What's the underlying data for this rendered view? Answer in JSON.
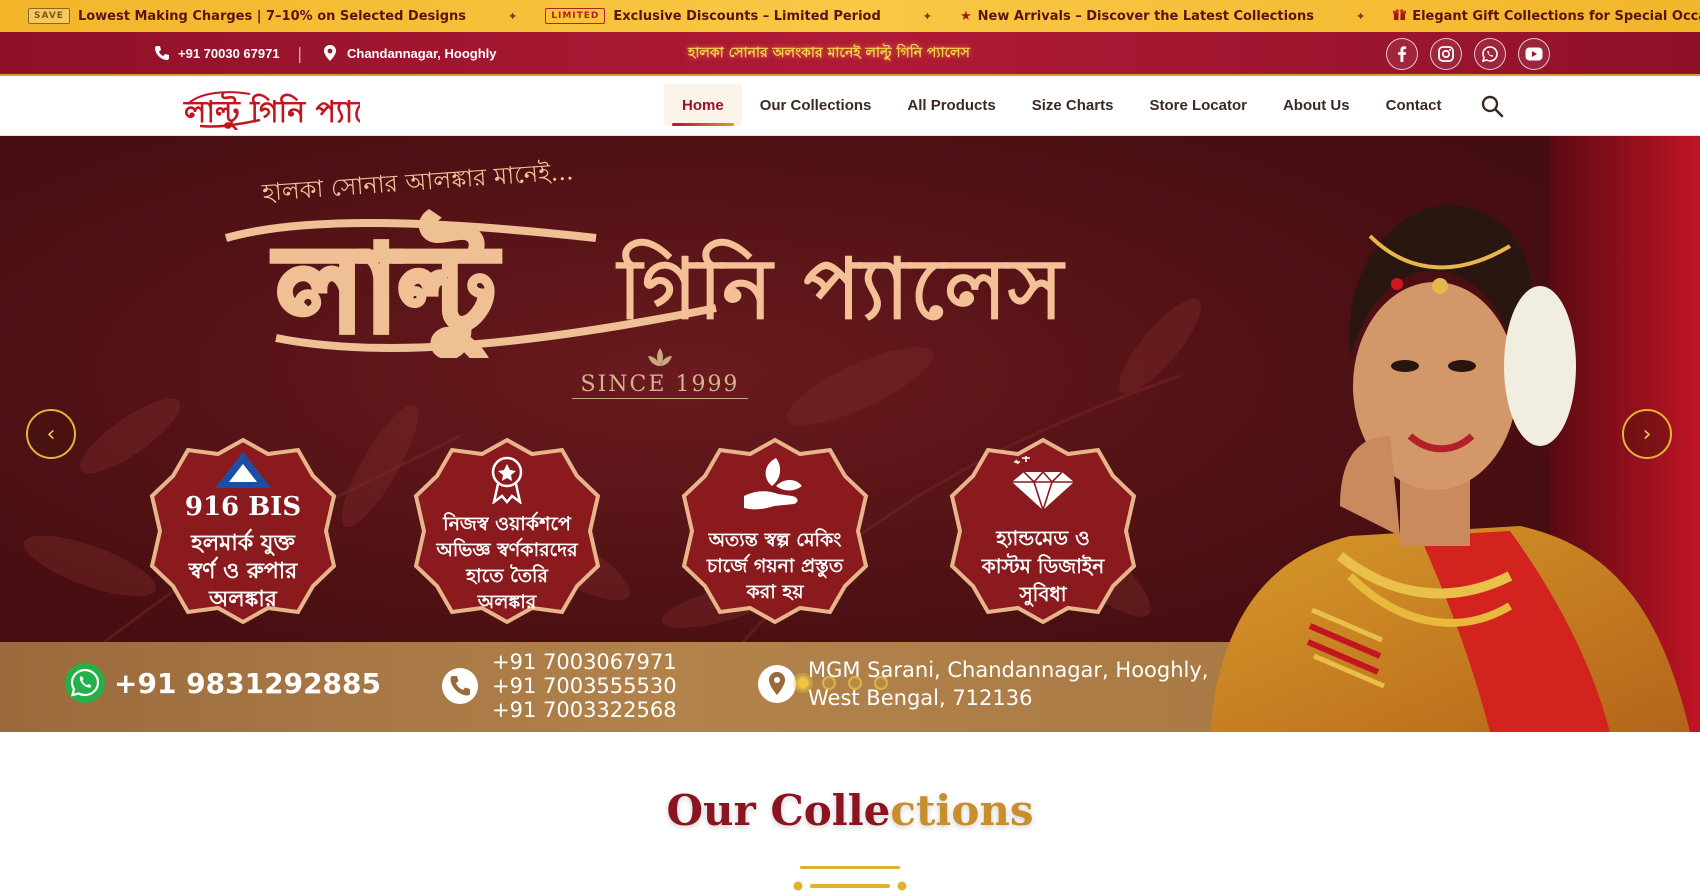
{
  "ticker": {
    "items": [
      {
        "tag": "SAVE",
        "text": "Lowest Making Charges | 7–10% on Selected Designs"
      },
      {
        "tag": "LIMITED",
        "text": "Exclusive Discounts – Limited Period"
      },
      {
        "icon": "star-icon",
        "text": "New Arrivals – Discover the Latest Collections"
      },
      {
        "icon": "gift-icon",
        "text": "Elegant Gift Collections for Special Occasions"
      }
    ],
    "separator": "✦"
  },
  "topbar": {
    "phone": "+91 70030 67971",
    "divider": "|",
    "location": "Chandannagar, Hooghly",
    "tagline": "হালকা সোনার অলংকার মানেই লাল্টু গিনি প্যালেস",
    "socials": [
      "facebook-icon",
      "instagram-icon",
      "whatsapp-icon",
      "youtube-icon"
    ]
  },
  "nav": {
    "logo_text": "লাল্টু গিনি প্যালেস",
    "items": [
      "Home",
      "Our Collections",
      "All Products",
      "Size Charts",
      "Store Locator",
      "About Us",
      "Contact"
    ],
    "active": "Home"
  },
  "hero": {
    "subtitle": "হালকা সোনার আলঙ্কার মানেই...",
    "title_big": "লাল্টু",
    "title_rest": "গিনি প্যালেস",
    "since": "SINCE 1999",
    "badges": [
      {
        "lines": [
          "916 BIS",
          "হলমার্ক যুক্ত",
          "স্বর্ণ ও রুপার",
          "অলঙ্কার"
        ]
      },
      {
        "lines": [
          "নিজস্ব ওয়ার্কশপে",
          "অভিজ্ঞ স্বর্ণকারদের",
          "হাতে তৈরি",
          "অলঙ্কার"
        ]
      },
      {
        "lines": [
          "অত্যন্ত স্বল্প মেকিং",
          "চার্জে গয়না প্রস্তুত",
          "করা হয়"
        ]
      },
      {
        "lines": [
          "হ্যান্ডমেড ও",
          "কাস্টম ডিজাইন",
          "সুবিধা"
        ]
      }
    ],
    "whatsapp": "+91 9831292885",
    "phones": [
      "+91 7003067971",
      "+91 7003555530",
      "+91 7003322568"
    ],
    "address": [
      "MGM Sarani, Chandannagar, Hooghly,",
      "West Bengal, 712136"
    ],
    "prev": "‹",
    "next": "›",
    "slides": 4,
    "active_slide": 1
  },
  "section": {
    "title_a": "Our Colle",
    "title_b": "ctions"
  },
  "colors": {
    "maroon": "#8e1128",
    "gold": "#f3b52a",
    "accent": "#b3142c"
  }
}
